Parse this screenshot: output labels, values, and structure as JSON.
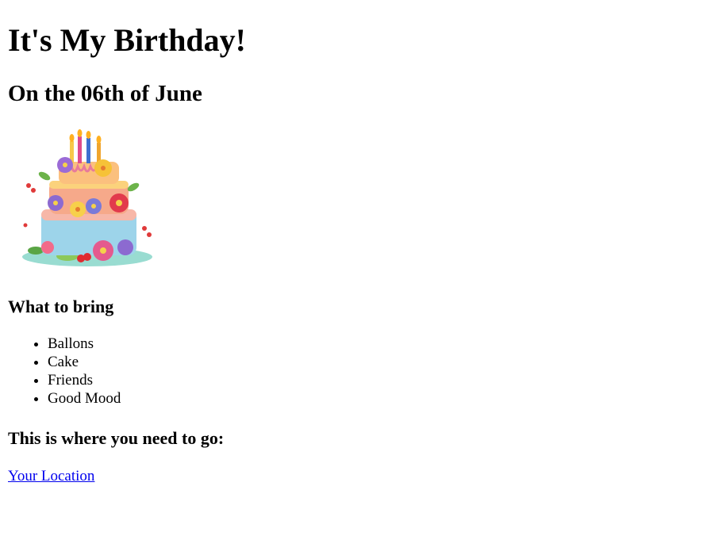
{
  "heading": "It's My Birthday!",
  "subheading": "On the 06th of June",
  "image": {
    "icon": "birthday-cake-image"
  },
  "bring": {
    "title": "What to bring",
    "items": [
      "Ballons",
      "Cake",
      "Friends",
      "Good Mood"
    ]
  },
  "directions": {
    "title": "This is where you need to go:",
    "link_text": "Your Location",
    "link_color": "#0000ee"
  }
}
